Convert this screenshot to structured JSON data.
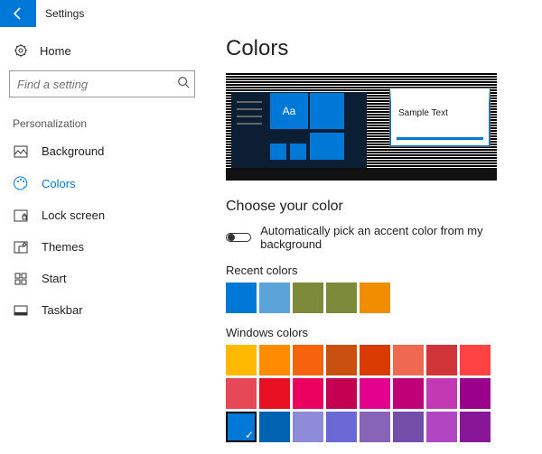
{
  "titlebar": {
    "title": "Settings"
  },
  "sidebar": {
    "home": "Home",
    "search_placeholder": "Find a setting",
    "section": "Personalization",
    "items": [
      {
        "label": "Background"
      },
      {
        "label": "Colors"
      },
      {
        "label": "Lock screen"
      },
      {
        "label": "Themes"
      },
      {
        "label": "Start"
      },
      {
        "label": "Taskbar"
      }
    ]
  },
  "content": {
    "title": "Colors",
    "preview": {
      "sample_text": "Sample Text",
      "tile_label": "Aa"
    },
    "choose_heading": "Choose your color",
    "auto_pick_label": "Automatically pick an accent color from my background",
    "recent_label": "Recent colors",
    "recent_colors": [
      "#0078d7",
      "#5aa4d9",
      "#7c8a3a",
      "#7c8a3a",
      "#f28c00"
    ],
    "windows_label": "Windows colors",
    "windows_colors": [
      "#ffb900",
      "#ff8c00",
      "#f7630c",
      "#ca5010",
      "#da3b01",
      "#ef6950",
      "#d13438",
      "#ff4343",
      "#e74856",
      "#e81123",
      "#ea005e",
      "#c30052",
      "#e3008c",
      "#bf0077",
      "#c239b3",
      "#9a0089",
      "#0078d7",
      "#0063b1",
      "#8e8cd8",
      "#6b69d6",
      "#8764b8",
      "#744da9",
      "#b146c2",
      "#881798"
    ],
    "selected_index": 16
  }
}
